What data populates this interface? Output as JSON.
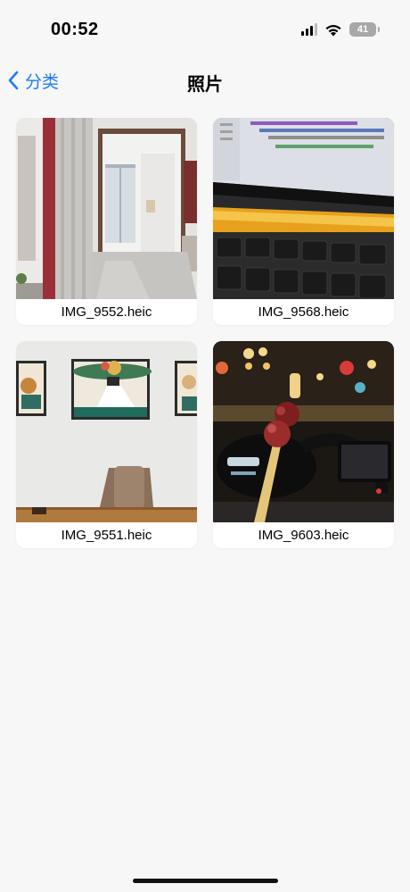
{
  "status_bar": {
    "time": "00:52",
    "battery_level": "41",
    "signal_icon": "cellular-signal-icon",
    "wifi_icon": "wifi-icon"
  },
  "nav": {
    "back_label": "分类",
    "title": "照片",
    "accent_color": "#1f7cf5"
  },
  "photos": [
    {
      "filename": "IMG_9552.heic",
      "thumb_icon": "room-photo-thumbnail"
    },
    {
      "filename": "IMG_9568.heic",
      "thumb_icon": "laptop-photo-thumbnail"
    },
    {
      "filename": "IMG_9551.heic",
      "thumb_icon": "wall-art-photo-thumbnail"
    },
    {
      "filename": "IMG_9603.heic",
      "thumb_icon": "candied-fruit-photo-thumbnail"
    }
  ]
}
